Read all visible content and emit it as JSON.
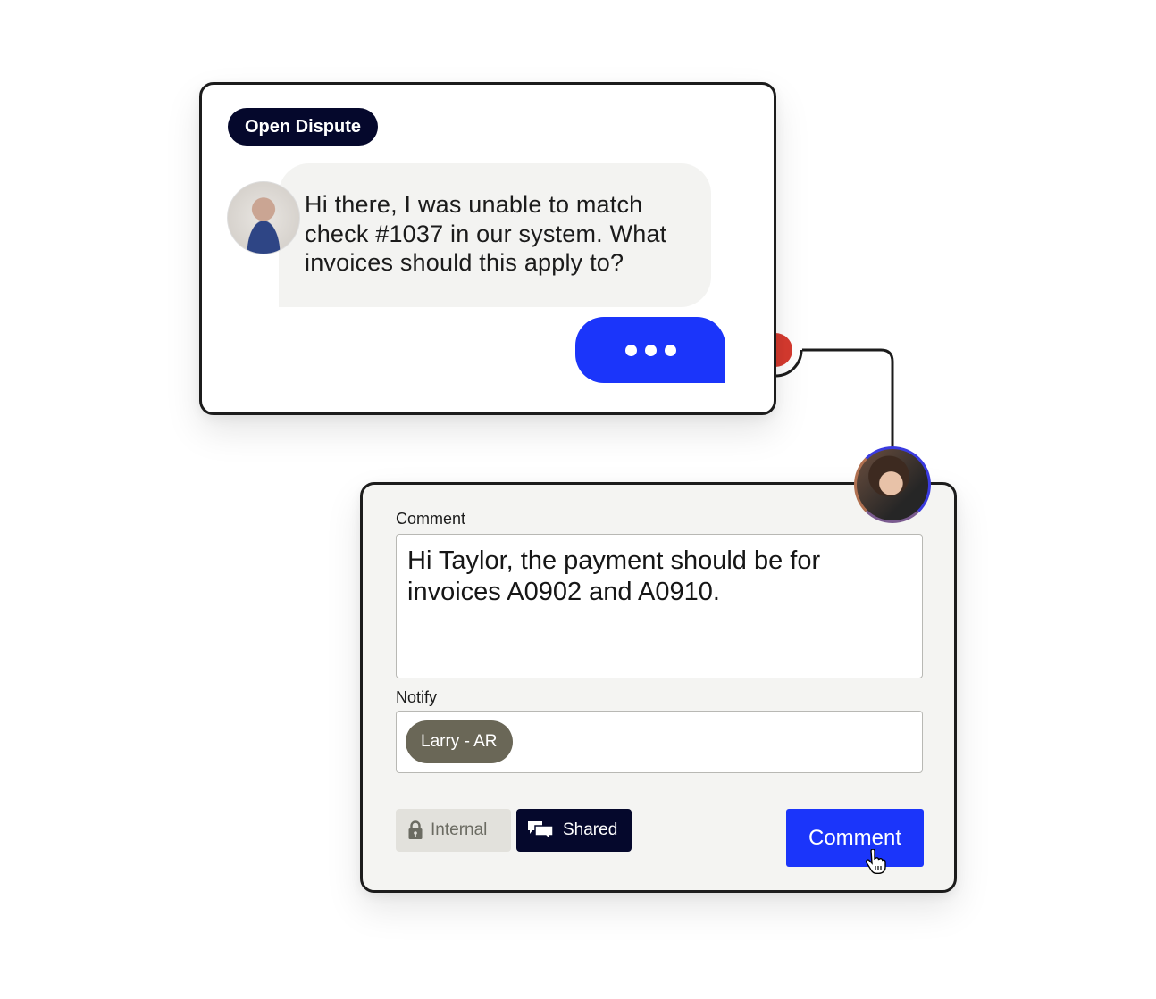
{
  "dispute_card": {
    "badge": "Open Dispute",
    "message": "Hi there, I was unable to match check #1037 in our system. What invoices should this apply to?",
    "sender_avatar": "customer-avatar",
    "typing_indicator": "typing-dots",
    "status_dot_color": "#d63a2f"
  },
  "comment_card": {
    "responder_avatar": "agent-avatar",
    "comment_label": "Comment",
    "comment_value": "Hi Taylor, the payment should be for invoices A0902 and A0910.",
    "notify_label": "Notify",
    "notify_chips": [
      "Larry - AR"
    ],
    "visibility": {
      "internal_label": "Internal",
      "internal_icon": "lock-icon",
      "shared_label": "Shared",
      "shared_icon": "chat-bubbles-icon",
      "selected": "Shared"
    },
    "submit_label": "Comment"
  },
  "colors": {
    "brand_blue": "#1b35fa",
    "navy": "#05082c",
    "chip": "#6a6757",
    "alert_red": "#d63a2f"
  }
}
